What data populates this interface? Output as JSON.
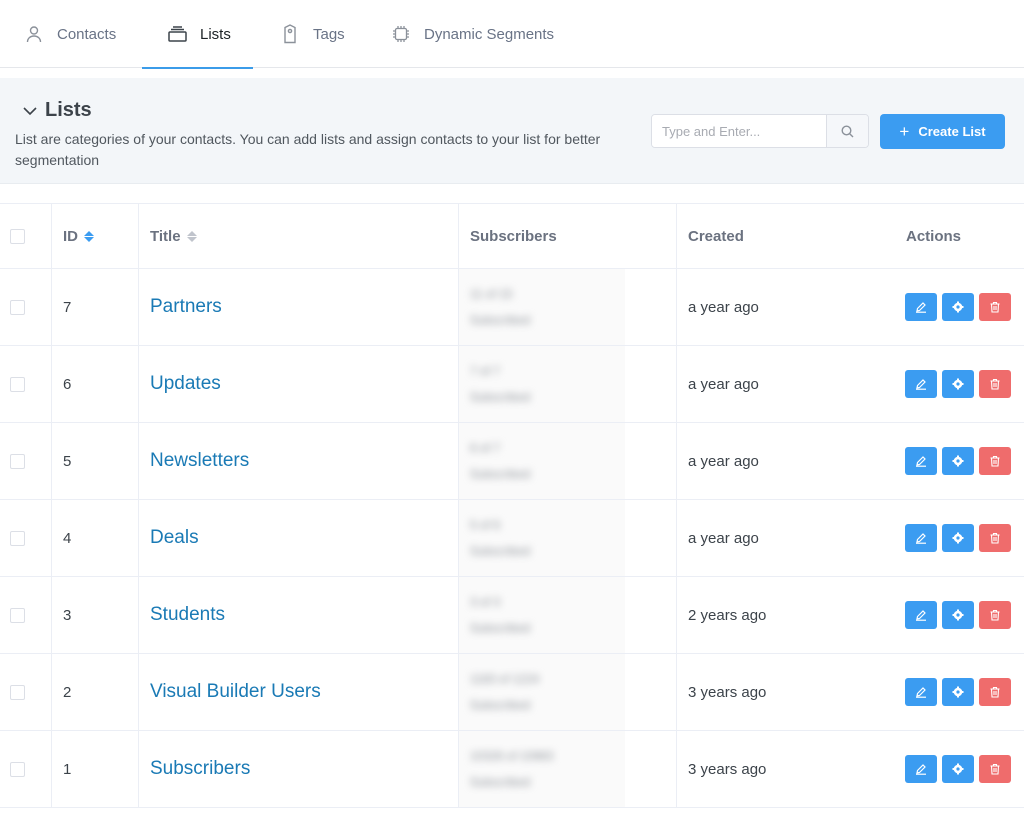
{
  "tabs": [
    {
      "label": "Contacts",
      "icon": "user-icon"
    },
    {
      "label": "Lists",
      "icon": "list-stack-icon"
    },
    {
      "label": "Tags",
      "icon": "tag-icon"
    },
    {
      "label": "Dynamic Segments",
      "icon": "chip-icon"
    }
  ],
  "active_tab": "Lists",
  "section": {
    "title": "Lists",
    "description": "List are categories of your contacts. You can add lists and assign contacts to your list for better segmentation"
  },
  "search": {
    "placeholder": "Type and Enter..."
  },
  "create_button": {
    "label": "Create List"
  },
  "table": {
    "headers": {
      "id": "ID",
      "title": "Title",
      "subscribers": "Subscribers",
      "created": "Created",
      "actions": "Actions"
    },
    "rows": [
      {
        "id": "7",
        "title": "Partners",
        "subscribers": "11 of 15",
        "subscribers_sub": "Subscribed",
        "created": "a year ago"
      },
      {
        "id": "6",
        "title": "Updates",
        "subscribers": "7 of 7",
        "subscribers_sub": "Subscribed",
        "created": "a year ago"
      },
      {
        "id": "5",
        "title": "Newsletters",
        "subscribers": "6 of 7",
        "subscribers_sub": "Subscribed",
        "created": "a year ago"
      },
      {
        "id": "4",
        "title": "Deals",
        "subscribers": "5 of 6",
        "subscribers_sub": "Subscribed",
        "created": "a year ago"
      },
      {
        "id": "3",
        "title": "Students",
        "subscribers": "3 of 3",
        "subscribers_sub": "Subscribed",
        "created": "2 years ago"
      },
      {
        "id": "2",
        "title": "Visual Builder Users",
        "subscribers": "1183 of 1224",
        "subscribers_sub": "Subscribed",
        "created": "3 years ago"
      },
      {
        "id": "1",
        "title": "Subscribers",
        "subscribers": "10326 of 10983",
        "subscribers_sub": "Subscribed",
        "created": "3 years ago"
      }
    ]
  },
  "colors": {
    "accent": "#3b9cf1",
    "danger": "#ef6c6c",
    "link": "#1a7ab5"
  }
}
